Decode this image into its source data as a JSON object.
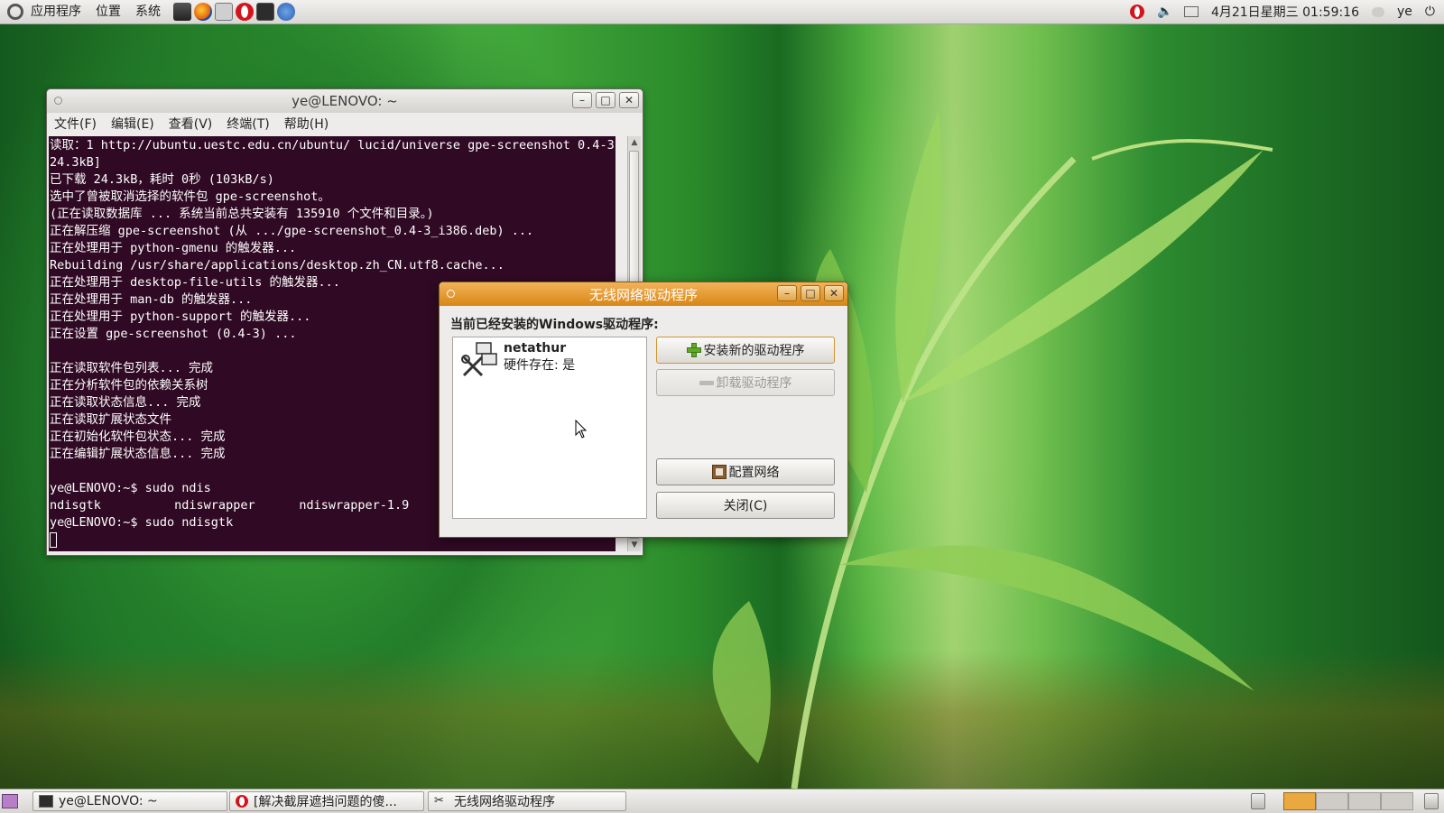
{
  "top_panel": {
    "menus": [
      "应用程序",
      "位置",
      "系统"
    ],
    "launchers": [
      "movie-player-icon",
      "firefox-icon",
      "screenshot-icon",
      "opera-icon",
      "terminal-icon",
      "help-icon"
    ],
    "clock": "4月21日星期三 01:59:16",
    "user": "ye"
  },
  "terminal": {
    "title": "ye@LENOVO: ~",
    "menus": [
      "文件(F)",
      "编辑(E)",
      "查看(V)",
      "终端(T)",
      "帮助(H)"
    ],
    "lines": [
      "读取：1 http://ubuntu.uestc.edu.cn/ubuntu/ lucid/universe gpe-screenshot 0.4-3 [",
      "24.3kB]",
      "已下载 24.3kB，耗时 0秒 (103kB/s)",
      "选中了曾被取消选择的软件包 gpe-screenshot。",
      "(正在读取数据库 ... 系统当前总共安装有 135910 个文件和目录。)",
      "正在解压缩 gpe-screenshot (从 .../gpe-screenshot_0.4-3_i386.deb) ...",
      "正在处理用于 python-gmenu 的触发器...",
      "Rebuilding /usr/share/applications/desktop.zh_CN.utf8.cache...",
      "正在处理用于 desktop-file-utils 的触发器...",
      "正在处理用于 man-db 的触发器...",
      "正在处理用于 python-support 的触发器...",
      "正在设置 gpe-screenshot (0.4-3) ...",
      "",
      "正在读取软件包列表... 完成",
      "正在分析软件包的依赖关系树",
      "正在读取状态信息... 完成",
      "正在读取扩展状态文件",
      "正在初始化软件包状态... 完成",
      "正在编辑扩展状态信息... 完成",
      "",
      "ye@LENOVO:~$ sudo ndis",
      "ndisgtk          ndiswrapper      ndiswrapper-1.9",
      "ye@LENOVO:~$ sudo ndisgtk"
    ]
  },
  "dialog": {
    "title": "无线网络驱动程序",
    "heading": "当前已经安装的Windows驱动程序:",
    "driver_name": "netathur",
    "driver_status": "硬件存在: 是",
    "install_label": "安装新的驱动程序",
    "uninstall_label": "卸载驱动程序",
    "config_label": "配置网络",
    "close_label": "关闭(C)"
  },
  "taskbar": {
    "tasks": [
      {
        "label": "ye@LENOVO: ~",
        "icon": "terminal-icon"
      },
      {
        "label": "[解决截屏遮挡问题的傻...",
        "icon": "opera-icon"
      },
      {
        "label": "无线网络驱动程序",
        "icon": "wireless-tools-icon"
      }
    ],
    "workspaces": 4,
    "active_workspace": 1
  },
  "colors": {
    "terminal_bg": "#300a24",
    "dialog_title_accent": "#e39427",
    "panel_bg": "#e4e2de"
  }
}
